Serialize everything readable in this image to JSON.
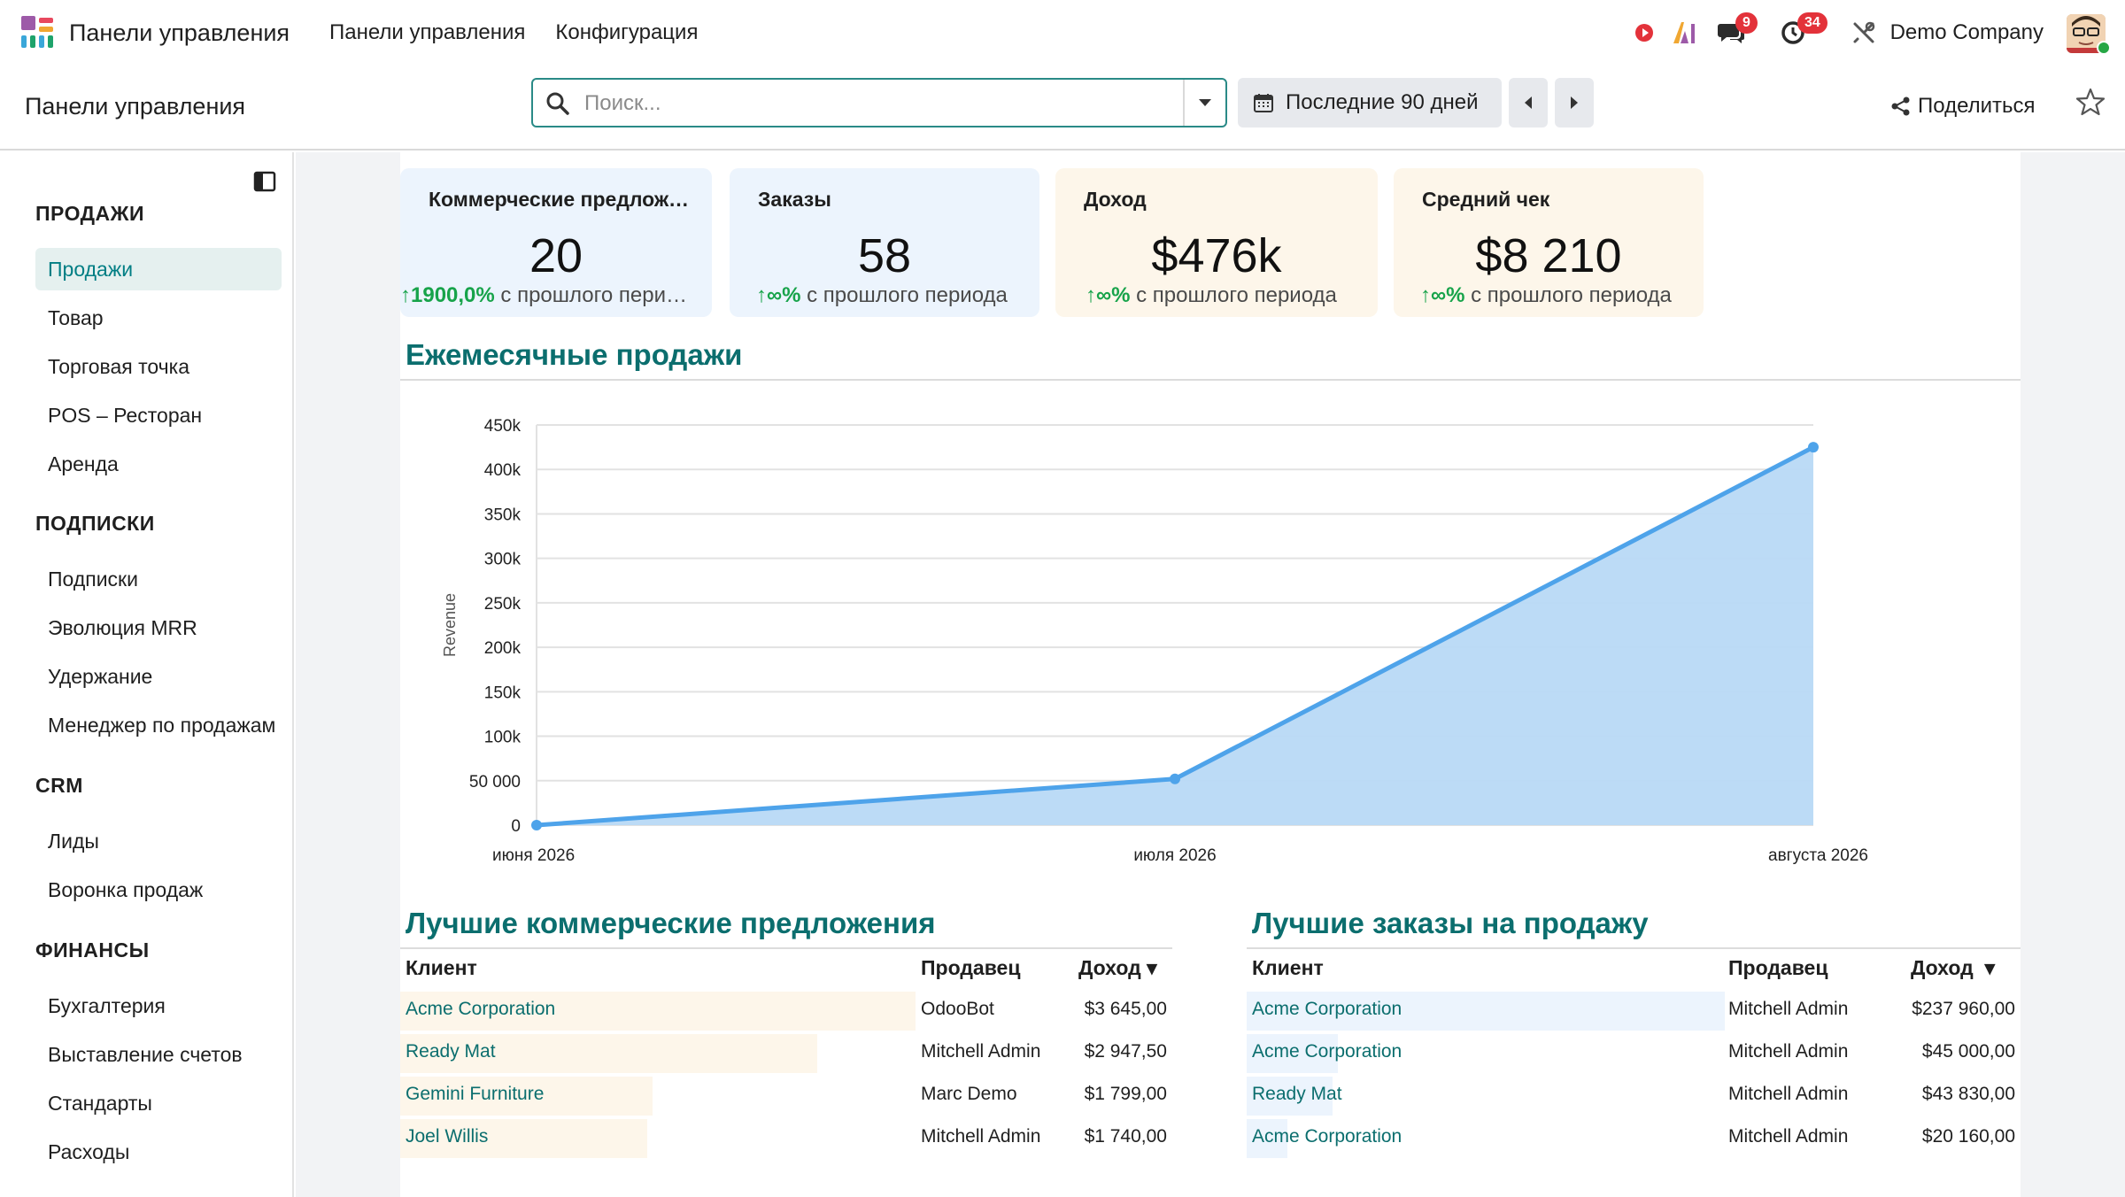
{
  "navbar": {
    "app_title": "Панели управления",
    "menu": [
      "Панели управления",
      "Конфигурация"
    ],
    "chat_count": "9",
    "activity_count": "34",
    "company": "Demo Company"
  },
  "control": {
    "breadcrumb": "Панели управления",
    "search_placeholder": "Поиск...",
    "date_range": "Последние 90 дней",
    "share_label": "Поделиться"
  },
  "sidebar": {
    "sections": [
      {
        "title": "ПРОДАЖИ",
        "items": [
          "Продажи",
          "Товар",
          "Торговая точка",
          "POS – Ресторан",
          "Аренда"
        ]
      },
      {
        "title": "ПОДПИСКИ",
        "items": [
          "Подписки",
          "Эволюция MRR",
          "Удержание",
          "Менеджер по продажам"
        ]
      },
      {
        "title": "CRM",
        "items": [
          "Лиды",
          "Воронка продаж"
        ]
      },
      {
        "title": "ФИНАНСЫ",
        "items": [
          "Бухгалтерия",
          "Выставление счетов",
          "Стандарты",
          "Расходы"
        ]
      }
    ],
    "active_item": "Продажи"
  },
  "kpis": [
    {
      "title": "Коммерческие предложения",
      "value": "20",
      "delta": "1900,0%",
      "delta_text": "с прошлого периода",
      "bg": "#ecf4fd"
    },
    {
      "title": "Заказы",
      "value": "58",
      "delta": "∞%",
      "delta_text": "с прошлого периода",
      "bg": "#ecf4fd"
    },
    {
      "title": "Доход",
      "value": "$476k",
      "delta": "∞%",
      "delta_text": "с прошлого периода",
      "bg": "#fdf6ea"
    },
    {
      "title": "Средний чек",
      "value": "$8 210",
      "delta": "∞%",
      "delta_text": "с прошлого периода",
      "bg": "#fdf6ea"
    }
  ],
  "monthly_sales_title": "Ежемесячные продажи",
  "chart_data": {
    "type": "area",
    "x": [
      "июня 2026",
      "июля 2026",
      "августа 2026"
    ],
    "series": [
      {
        "values": [
          0,
          52000,
          425000
        ]
      }
    ],
    "ylabel": "Revenue",
    "ylim": [
      0,
      450000
    ],
    "yticks": [
      "0",
      "50 000",
      "100k",
      "150k",
      "200k",
      "250k",
      "300k",
      "350k",
      "400k",
      "450k"
    ],
    "grid": true,
    "colors": {
      "line": "#4ea3ea",
      "fill": "#b8d9f6"
    }
  },
  "quotes": {
    "title": "Лучшие коммерческие предложения",
    "headers": [
      "Клиент",
      "Продавец",
      "Доход"
    ],
    "rows": [
      {
        "client": "Acme Corporation",
        "seller": "OdooBot",
        "amount": "$3 645,00",
        "ratio": 1.0
      },
      {
        "client": "Ready Mat",
        "seller": "Mitchell Admin",
        "amount": "$2 947,50",
        "ratio": 0.81
      },
      {
        "client": "Gemini Furniture",
        "seller": "Marc Demo",
        "amount": "$1 799,00",
        "ratio": 0.49
      },
      {
        "client": "Joel Willis",
        "seller": "Mitchell Admin",
        "amount": "$1 740,00",
        "ratio": 0.48
      }
    ]
  },
  "orders": {
    "title": "Лучшие заказы на продажу",
    "headers": [
      "Клиент",
      "Продавец",
      "Доход"
    ],
    "rows": [
      {
        "client": "Acme Corporation",
        "seller": "Mitchell Admin",
        "amount": "$237 960,00",
        "ratio": 1.0
      },
      {
        "client": "Acme Corporation",
        "seller": "Mitchell Admin",
        "amount": "$45 000,00",
        "ratio": 0.19
      },
      {
        "client": "Ready Mat",
        "seller": "Mitchell Admin",
        "amount": "$43 830,00",
        "ratio": 0.18
      },
      {
        "client": "Acme Corporation",
        "seller": "Mitchell Admin",
        "amount": "$20 160,00",
        "ratio": 0.085
      }
    ]
  }
}
